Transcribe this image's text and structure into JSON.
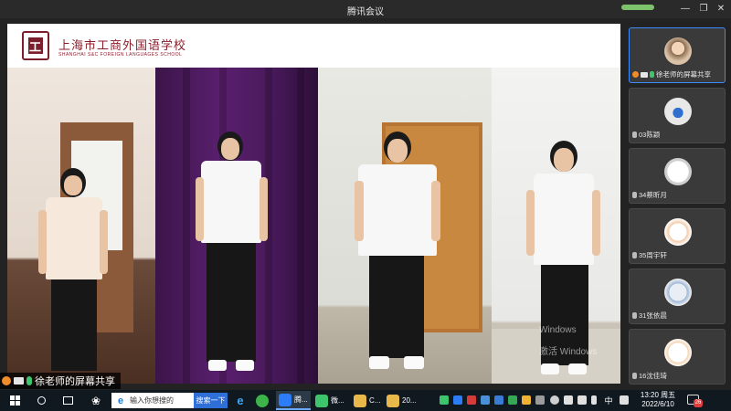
{
  "window": {
    "title": "腾讯会议"
  },
  "shared_screen": {
    "school_name_cn": "上海市工商外国语学校",
    "school_name_en": "SHANGHAI S&C FOREIGN LANGUAGES SCHOOL",
    "watermark_1": "Windows",
    "watermark_2": "激活 Windows"
  },
  "presenter_label": "徐老师的屏幕共享",
  "participants": [
    {
      "name": "徐老师的屏幕共享",
      "avatar": "teacher-avatar",
      "mic_on": true,
      "active": true
    },
    {
      "name": "03陈颖",
      "avatar": "sleeping-figure-avatar",
      "mic_on": false,
      "active": false
    },
    {
      "name": "34蔡昕月",
      "avatar": "cartoon-face-avatar",
      "mic_on": false,
      "active": false
    },
    {
      "name": "35周宇轩",
      "avatar": "cartoon-panda-avatar",
      "mic_on": false,
      "active": false
    },
    {
      "name": "31张依晨",
      "avatar": "cartoon-cat-avatar",
      "mic_on": false,
      "active": false
    },
    {
      "name": "16沈佳琦",
      "avatar": "cartoon-dog-avatar",
      "mic_on": false,
      "active": false
    }
  ],
  "taskbar": {
    "search_placeholder": "输入你想搜的",
    "search_button": "搜索一下",
    "apps": [
      {
        "label": "腾...",
        "icon": "tencent-meeting-icon",
        "color": "#2b7cf6",
        "active": true
      },
      {
        "label": "微...",
        "icon": "wechat-icon",
        "color": "#3ec46d",
        "active": false
      },
      {
        "label": "C...",
        "icon": "file-explorer-icon",
        "color": "#e8b84a",
        "active": false
      },
      {
        "label": "20...",
        "icon": "folder-icon",
        "color": "#e8b84a",
        "active": false
      }
    ],
    "ime": "中",
    "time": "13:20 周五",
    "date": "2022/6/10",
    "notification_count": "26"
  }
}
